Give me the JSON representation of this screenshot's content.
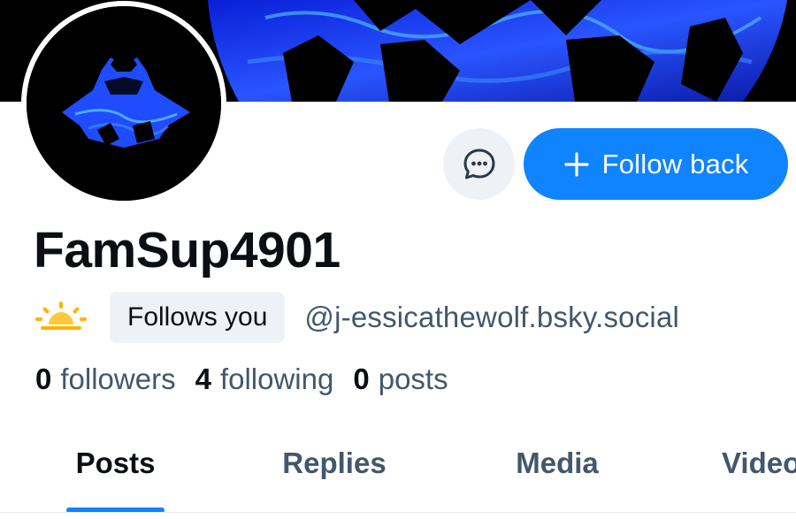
{
  "profile": {
    "display_name": "FamSup4901",
    "badge_label": "Follows you",
    "handle": "@j-essicathewolf.bsky.social",
    "status_emoji_icon": "sun-behind-horizon-icon"
  },
  "actions": {
    "message_icon": "chat-bubble-icon",
    "follow_back_label": "Follow back",
    "follow_back_icon": "plus-icon"
  },
  "stats": [
    {
      "value": "0",
      "label": "followers"
    },
    {
      "value": "4",
      "label": "following"
    },
    {
      "value": "0",
      "label": "posts"
    }
  ],
  "tabs": [
    {
      "label": "Posts",
      "active": true
    },
    {
      "label": "Replies",
      "active": false
    },
    {
      "label": "Media",
      "active": false
    },
    {
      "label": "Videos",
      "active": false
    }
  ],
  "colors": {
    "accent": "#1083fe",
    "muted_text": "#42576c",
    "badge_bg": "#eef1f5",
    "banner_blue": "#1a3cff"
  }
}
